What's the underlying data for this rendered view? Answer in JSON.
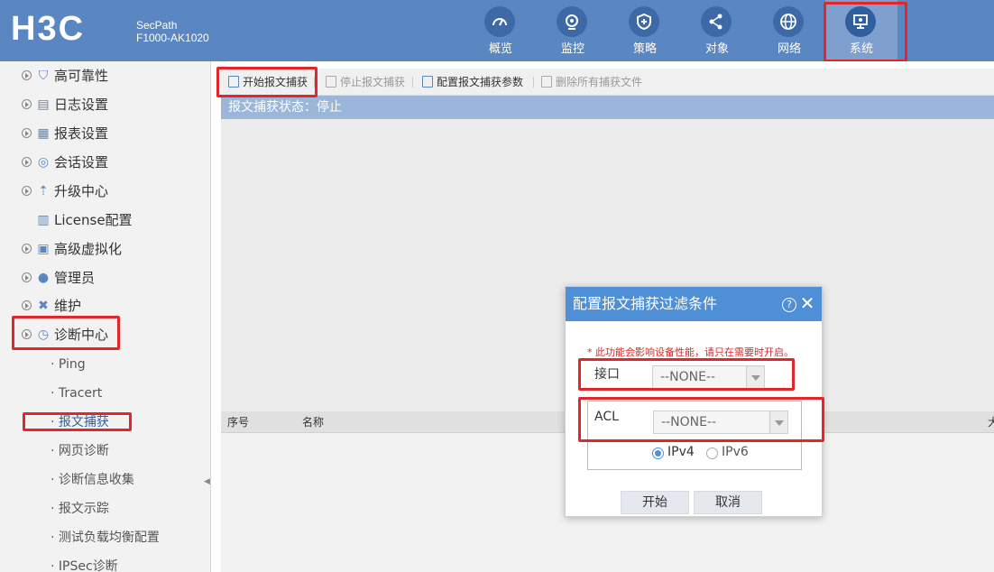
{
  "header": {
    "logo": "H3C",
    "product_line1": "SecPath",
    "product_line2": "F1000-AK1020",
    "nav": [
      {
        "label": "概览",
        "icon": "dashboard-icon"
      },
      {
        "label": "监控",
        "icon": "camera-icon"
      },
      {
        "label": "策略",
        "icon": "shield-plus-icon"
      },
      {
        "label": "对象",
        "icon": "share-icon"
      },
      {
        "label": "网络",
        "icon": "globe-icon"
      },
      {
        "label": "系统",
        "icon": "monitor-icon",
        "active": true
      }
    ]
  },
  "sidebar": {
    "items": [
      {
        "label": "高可靠性",
        "icon": "shield-icon"
      },
      {
        "label": "日志设置",
        "icon": "log-icon"
      },
      {
        "label": "报表设置",
        "icon": "report-icon"
      },
      {
        "label": "会话设置",
        "icon": "chat-icon"
      },
      {
        "label": "升级中心",
        "icon": "upload-icon"
      },
      {
        "label": "License配置",
        "icon": "license-icon"
      },
      {
        "label": "高级虚拟化",
        "icon": "virtual-icon"
      },
      {
        "label": "管理员",
        "icon": "users-icon"
      },
      {
        "label": "维护",
        "icon": "tools-icon"
      },
      {
        "label": "诊断中心",
        "icon": "diagnose-icon"
      }
    ],
    "sub_items": [
      {
        "label": "· Ping"
      },
      {
        "label": "· Tracert"
      },
      {
        "label": "· 报文捕获",
        "active": true
      },
      {
        "label": "· 网页诊断"
      },
      {
        "label": "· 诊断信息收集"
      },
      {
        "label": "· 报文示踪"
      },
      {
        "label": "· 测试负载均衡配置"
      },
      {
        "label": "· IPSec诊断"
      }
    ]
  },
  "toolbar": {
    "start_capture": "开始报文捕获",
    "stop_capture": "停止报文捕获",
    "config_params": "配置报文捕获参数",
    "delete_all": "删除所有捕获文件"
  },
  "status": {
    "text": "报文捕获状态：停止"
  },
  "table": {
    "columns": [
      "序号",
      "名称",
      "大"
    ]
  },
  "dialog": {
    "title": "配置报文捕获过滤条件",
    "help": "?",
    "close": "✕",
    "warning": "* 此功能会影响设备性能，请只在需要时开启。",
    "interface_label": "接口",
    "interface_value": "--NONE--",
    "acl_label": "ACL",
    "acl_value": "--NONE--",
    "ipv4_label": "IPv4",
    "ipv6_label": "IPv6",
    "ip_version_selected": "IPv4",
    "start_button": "开始",
    "cancel_button": "取消"
  },
  "colors": {
    "header_bg": "#5a86c2",
    "dialog_title_bg": "#4e8fd5",
    "highlight": "#e2262a",
    "status_bar_bg": "#9cb6da"
  }
}
